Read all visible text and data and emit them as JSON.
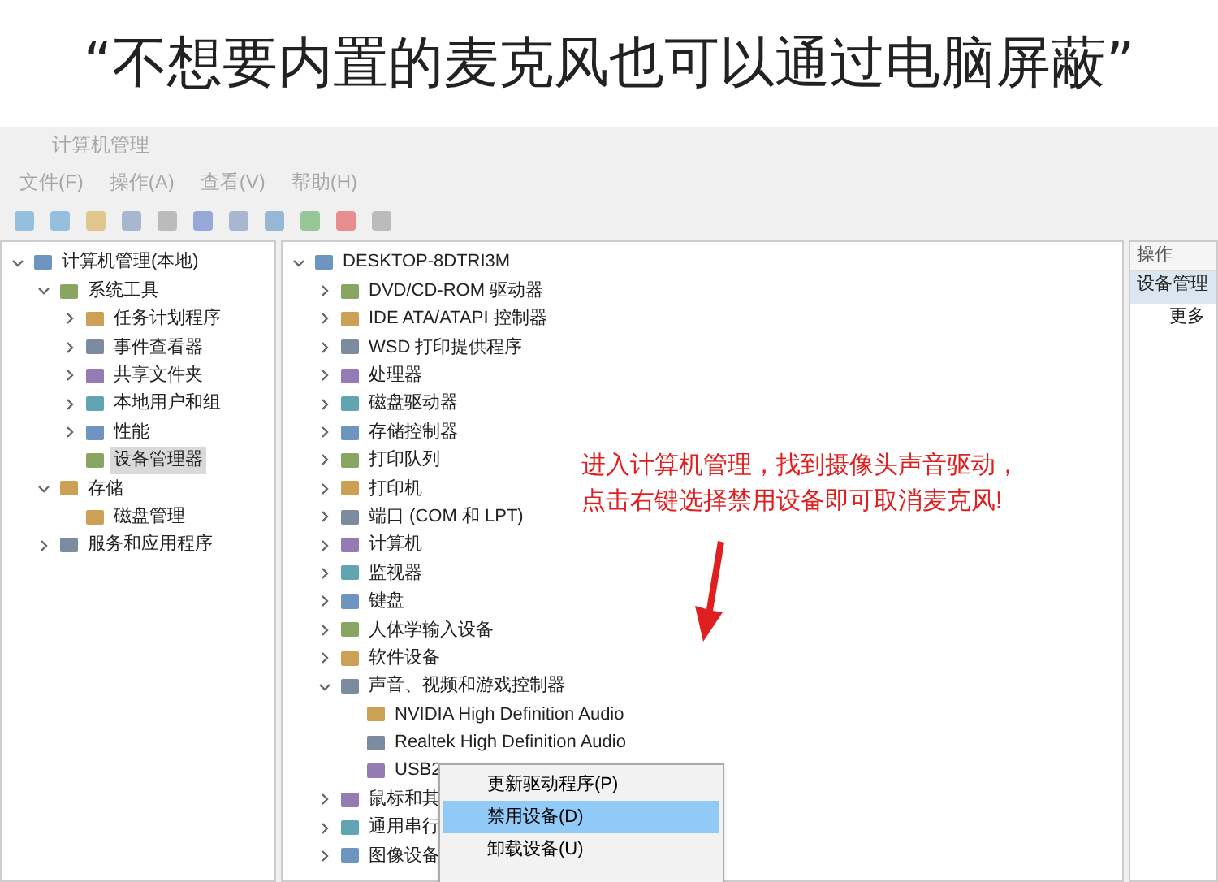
{
  "headline": "“不想要内置的麦克风也可以通过电脑屏蔽”",
  "window": {
    "title": "计算机管理"
  },
  "menu": [
    "文件(F)",
    "操作(A)",
    "查看(V)",
    "帮助(H)"
  ],
  "left_tree": [
    {
      "label": "计算机管理(本地)",
      "expanded": true,
      "selected": false,
      "children": [
        {
          "label": "系统工具",
          "expanded": true,
          "selected": false,
          "children": [
            {
              "label": "任务计划程序",
              "expanded": false,
              "selected": false
            },
            {
              "label": "事件查看器",
              "expanded": false,
              "selected": false
            },
            {
              "label": "共享文件夹",
              "expanded": false,
              "selected": false
            },
            {
              "label": "本地用户和组",
              "expanded": false,
              "selected": false
            },
            {
              "label": "性能",
              "expanded": false,
              "selected": false
            },
            {
              "label": "设备管理器",
              "selected": true
            }
          ]
        },
        {
          "label": "存储",
          "expanded": true,
          "selected": false,
          "children": [
            {
              "label": "磁盘管理",
              "selected": false
            }
          ]
        },
        {
          "label": "服务和应用程序",
          "expanded": false,
          "selected": false
        }
      ]
    }
  ],
  "device_tree": [
    {
      "label": "DESKTOP-8DTRI3M",
      "expanded": true,
      "children": [
        {
          "label": "DVD/CD-ROM 驱动器",
          "expanded": false
        },
        {
          "label": "IDE ATA/ATAPI 控制器",
          "expanded": false
        },
        {
          "label": "WSD 打印提供程序",
          "expanded": false
        },
        {
          "label": "处理器",
          "expanded": false
        },
        {
          "label": "磁盘驱动器",
          "expanded": false
        },
        {
          "label": "存储控制器",
          "expanded": false
        },
        {
          "label": "打印队列",
          "expanded": false
        },
        {
          "label": "打印机",
          "expanded": false
        },
        {
          "label": "端口 (COM 和 LPT)",
          "expanded": false
        },
        {
          "label": "计算机",
          "expanded": false
        },
        {
          "label": "监视器",
          "expanded": false
        },
        {
          "label": "键盘",
          "expanded": false
        },
        {
          "label": "人体学输入设备",
          "expanded": false
        },
        {
          "label": "软件设备",
          "expanded": false
        },
        {
          "label": "声音、视频和游戏控制器",
          "expanded": true,
          "children": [
            {
              "label": "NVIDIA High Definition Audio"
            },
            {
              "label": "Realtek High Definition Audio"
            },
            {
              "label": "USB2"
            }
          ]
        },
        {
          "label": "鼠标和其",
          "expanded": false
        },
        {
          "label": "通用串行",
          "expanded": false
        },
        {
          "label": "图像设备",
          "expanded": false
        }
      ]
    }
  ],
  "actions": {
    "header": "操作",
    "section": "设备管理",
    "items": [
      "更多"
    ]
  },
  "context_menu": [
    {
      "label": "更新驱动程序(P)",
      "selected": false
    },
    {
      "label": "禁用设备(D)",
      "selected": true
    },
    {
      "label": "卸载设备(U)",
      "selected": false
    }
  ],
  "annotation": [
    "进入计算机管理，找到摄像头声音驱动，",
    "点击右键选择禁用设备即可取消麦克风!"
  ]
}
